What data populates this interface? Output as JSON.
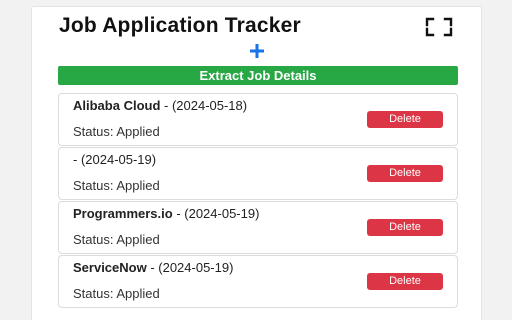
{
  "header": {
    "title": "Job Application Tracker",
    "expand_icon": "fullscreen-corners-icon",
    "add_icon": "plus-icon",
    "add_color": "#1a73e8"
  },
  "extract_button": {
    "label": "Extract Job Details",
    "color": "#28a745"
  },
  "jobs": [
    {
      "company": "Alibaba Cloud",
      "date_suffix": " - (2024-05-18)",
      "status": "Status: Applied",
      "delete_label": "Delete"
    },
    {
      "company": "",
      "date_suffix": "- (2024-05-19)",
      "status": "Status: Applied",
      "delete_label": "Delete"
    },
    {
      "company": "Programmers.io",
      "date_suffix": " - (2024-05-19)",
      "status": "Status: Applied",
      "delete_label": "Delete"
    },
    {
      "company": "ServiceNow",
      "date_suffix": " - (2024-05-19)",
      "status": "Status: Applied",
      "delete_label": "Delete"
    }
  ],
  "colors": {
    "delete": "#dc3545"
  }
}
